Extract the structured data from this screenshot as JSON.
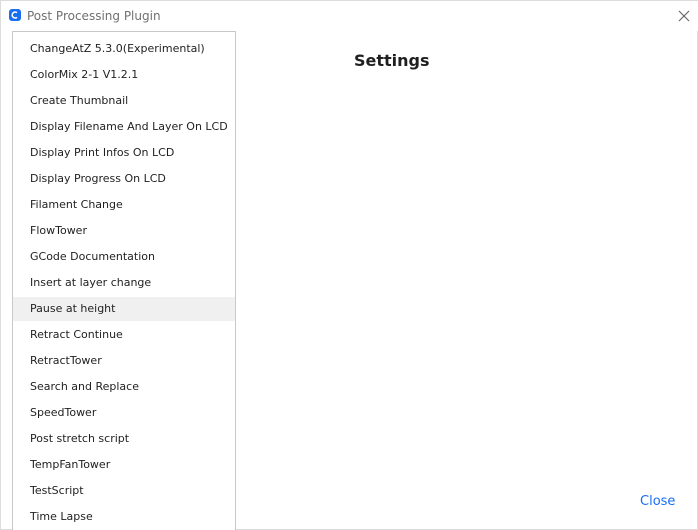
{
  "window": {
    "title": "Post Processing Plugin",
    "app_icon": "cura-logo-icon",
    "close_icon": "close-icon"
  },
  "scripts": [
    {
      "label": "ChangeAtZ 5.3.0(Experimental)"
    },
    {
      "label": "ColorMix 2-1 V1.2.1"
    },
    {
      "label": "Create Thumbnail"
    },
    {
      "label": "Display Filename And Layer On LCD"
    },
    {
      "label": "Display Print Infos On LCD"
    },
    {
      "label": "Display Progress On LCD"
    },
    {
      "label": "Filament Change"
    },
    {
      "label": "FlowTower"
    },
    {
      "label": "GCode Documentation"
    },
    {
      "label": "Insert at layer change"
    },
    {
      "label": "Pause at height",
      "hovered": true
    },
    {
      "label": "Retract Continue"
    },
    {
      "label": "RetractTower"
    },
    {
      "label": "Search and Replace"
    },
    {
      "label": "SpeedTower"
    },
    {
      "label": "Post stretch script"
    },
    {
      "label": "TempFanTower"
    },
    {
      "label": "TestScript"
    },
    {
      "label": "Time Lapse"
    }
  ],
  "settings": {
    "heading": "Settings"
  },
  "footer": {
    "close_label": "Close"
  },
  "colors": {
    "accent": "#196ef0",
    "hover_bg": "#f0f0f0",
    "text": "#1f1f1f"
  }
}
